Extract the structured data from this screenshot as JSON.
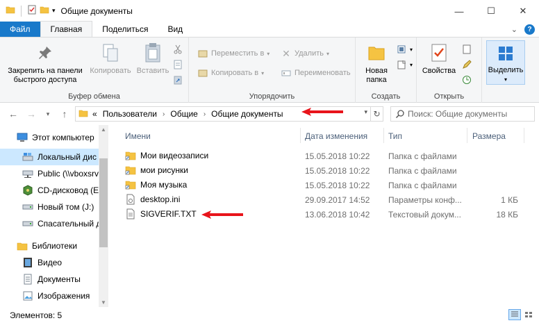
{
  "window": {
    "title": "Общие документы",
    "controls": {
      "minimize": "—",
      "maximize": "☐",
      "close": "✕"
    }
  },
  "ribbon_tabs": {
    "file": "Файл",
    "home": "Главная",
    "share": "Поделиться",
    "view": "Вид"
  },
  "ribbon": {
    "clipboard": {
      "label": "Буфер обмена",
      "pin": "Закрепить на панели быстрого доступа",
      "copy": "Копировать",
      "paste": "Вставить"
    },
    "organize": {
      "label": "Упорядочить",
      "move_to": "Переместить в",
      "copy_to": "Копировать в",
      "delete": "Удалить",
      "rename": "Переименовать"
    },
    "new": {
      "label": "Создать",
      "new_folder": "Новая папка"
    },
    "open": {
      "label": "Открыть",
      "properties": "Свойства"
    },
    "select": {
      "select": "Выделить"
    }
  },
  "address": {
    "overflow": "«",
    "crumbs": [
      "Пользователи",
      "Общие",
      "Общие документы"
    ],
    "search_placeholder": "Поиск: Общие документы"
  },
  "nav": {
    "items": [
      {
        "label": "Этот компьютер",
        "icon": "computer-icon"
      },
      {
        "label": "Локальный дис",
        "icon": "local-disk-icon",
        "selected": true
      },
      {
        "label": "Public (\\\\vboxsrv",
        "icon": "network-drive-icon"
      },
      {
        "label": "CD-дисковод (E",
        "icon": "cd-drive-icon"
      },
      {
        "label": "Новый том (J:)",
        "icon": "drive-icon"
      },
      {
        "label": "Спасательный д",
        "icon": "drive-icon"
      },
      {
        "label": "Библиотеки",
        "icon": "libraries-icon"
      },
      {
        "label": "Видео",
        "icon": "video-library-icon"
      },
      {
        "label": "Документы",
        "icon": "documents-library-icon"
      },
      {
        "label": "Изображения",
        "icon": "pictures-library-icon"
      }
    ]
  },
  "columns": {
    "name": "Имени",
    "date": "Дата изменения",
    "type": "Тип",
    "size": "Размера"
  },
  "files": [
    {
      "name": "Мои видеозаписи",
      "date": "15.05.2018 10:22",
      "type": "Папка с файлами",
      "size": "",
      "icon": "folder-shortcut-icon"
    },
    {
      "name": "мои рисунки",
      "date": "15.05.2018 10:22",
      "type": "Папка с файлами",
      "size": "",
      "icon": "folder-shortcut-icon"
    },
    {
      "name": "Моя музыка",
      "date": "15.05.2018 10:22",
      "type": "Папка с файлами",
      "size": "",
      "icon": "folder-shortcut-icon"
    },
    {
      "name": "desktop.ini",
      "date": "29.09.2017 14:52",
      "type": "Параметры конф...",
      "size": "1 КБ",
      "icon": "settings-file-icon"
    },
    {
      "name": "SIGVERIF.TXT",
      "date": "13.06.2018 10:42",
      "type": "Текстовый докум...",
      "size": "18 КБ",
      "icon": "text-file-icon"
    }
  ],
  "status": {
    "count": "Элементов: 5"
  },
  "colors": {
    "accent": "#1979ca",
    "selection": "#cce8ff",
    "arrow": "#e8141b"
  }
}
